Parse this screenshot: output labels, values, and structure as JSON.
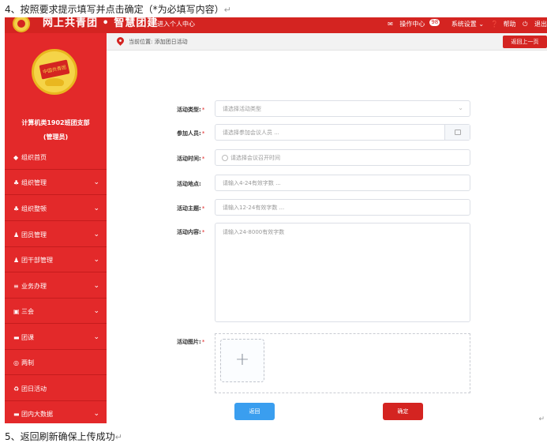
{
  "doc": {
    "step4": "4、按照要求提示填写并点击确定（*为必填写内容）",
    "step5": "5、返回刷新确保上传成功",
    "return_mark": "↵",
    "side_mark": "↵"
  },
  "header": {
    "brand": "网上共青团 • 智慧团建",
    "personal_center": "进入个人中心",
    "operation_center": "操作中心",
    "badge_count": "98",
    "system_settings": "系统设置",
    "help": "帮助",
    "logout": "退出",
    "brand_color": "#d42421"
  },
  "sidebar": {
    "emblem_text": "中国共青团",
    "org_name": "计算机类1902班团支部",
    "org_role": "(管理员)",
    "items": [
      {
        "label": "组织首页",
        "icon": "home-icon",
        "glyph": "◆",
        "has_arrow": false
      },
      {
        "label": "组织管理",
        "icon": "org-icon",
        "glyph": "♣",
        "has_arrow": true
      },
      {
        "label": "组织整顿",
        "icon": "org-fix-icon",
        "glyph": "♣",
        "has_arrow": true
      },
      {
        "label": "团员管理",
        "icon": "members-icon",
        "glyph": "♟",
        "has_arrow": true
      },
      {
        "label": "团干部管理",
        "icon": "cadres-icon",
        "glyph": "♟",
        "has_arrow": true
      },
      {
        "label": "业务办理",
        "icon": "business-icon",
        "glyph": "≡",
        "has_arrow": true
      },
      {
        "label": "三会",
        "icon": "meetings-icon",
        "glyph": "▣",
        "has_arrow": true
      },
      {
        "label": "团课",
        "icon": "lessons-icon",
        "glyph": "▬",
        "has_arrow": true
      },
      {
        "label": "两制",
        "icon": "system-icon",
        "glyph": "◎",
        "has_arrow": false
      },
      {
        "label": "团日活动",
        "icon": "activity-icon",
        "glyph": "♻",
        "has_arrow": false
      },
      {
        "label": "团内大数据",
        "icon": "data-icon",
        "glyph": "▬",
        "has_arrow": true
      }
    ],
    "chevron": "⌄"
  },
  "breadcrumb": {
    "text": "当前位置: 添加团日活动",
    "back_button": "返回上一页"
  },
  "form": {
    "required_mark": "*",
    "activity_type": {
      "label": "活动类型:",
      "placeholder": "请选择活动类型"
    },
    "participants": {
      "label": "参加人员:",
      "placeholder": "请选择参加会议人员 ..."
    },
    "activity_time": {
      "label": "活动时间:",
      "placeholder": "请选择会议召开时间"
    },
    "location": {
      "label": "活动地点:",
      "placeholder": "请输入4-24有效字数 ..."
    },
    "theme": {
      "label": "活动主题:",
      "placeholder": "请输入12-24有效字数 ..."
    },
    "content": {
      "label": "活动内容:",
      "placeholder": "请输入24-8000有效字数"
    },
    "images": {
      "label": "活动图片:",
      "plus": "+"
    },
    "back_button": "返回",
    "confirm_button": "确定",
    "confirm_color": "#d42421",
    "back_color": "#3a9eef"
  }
}
